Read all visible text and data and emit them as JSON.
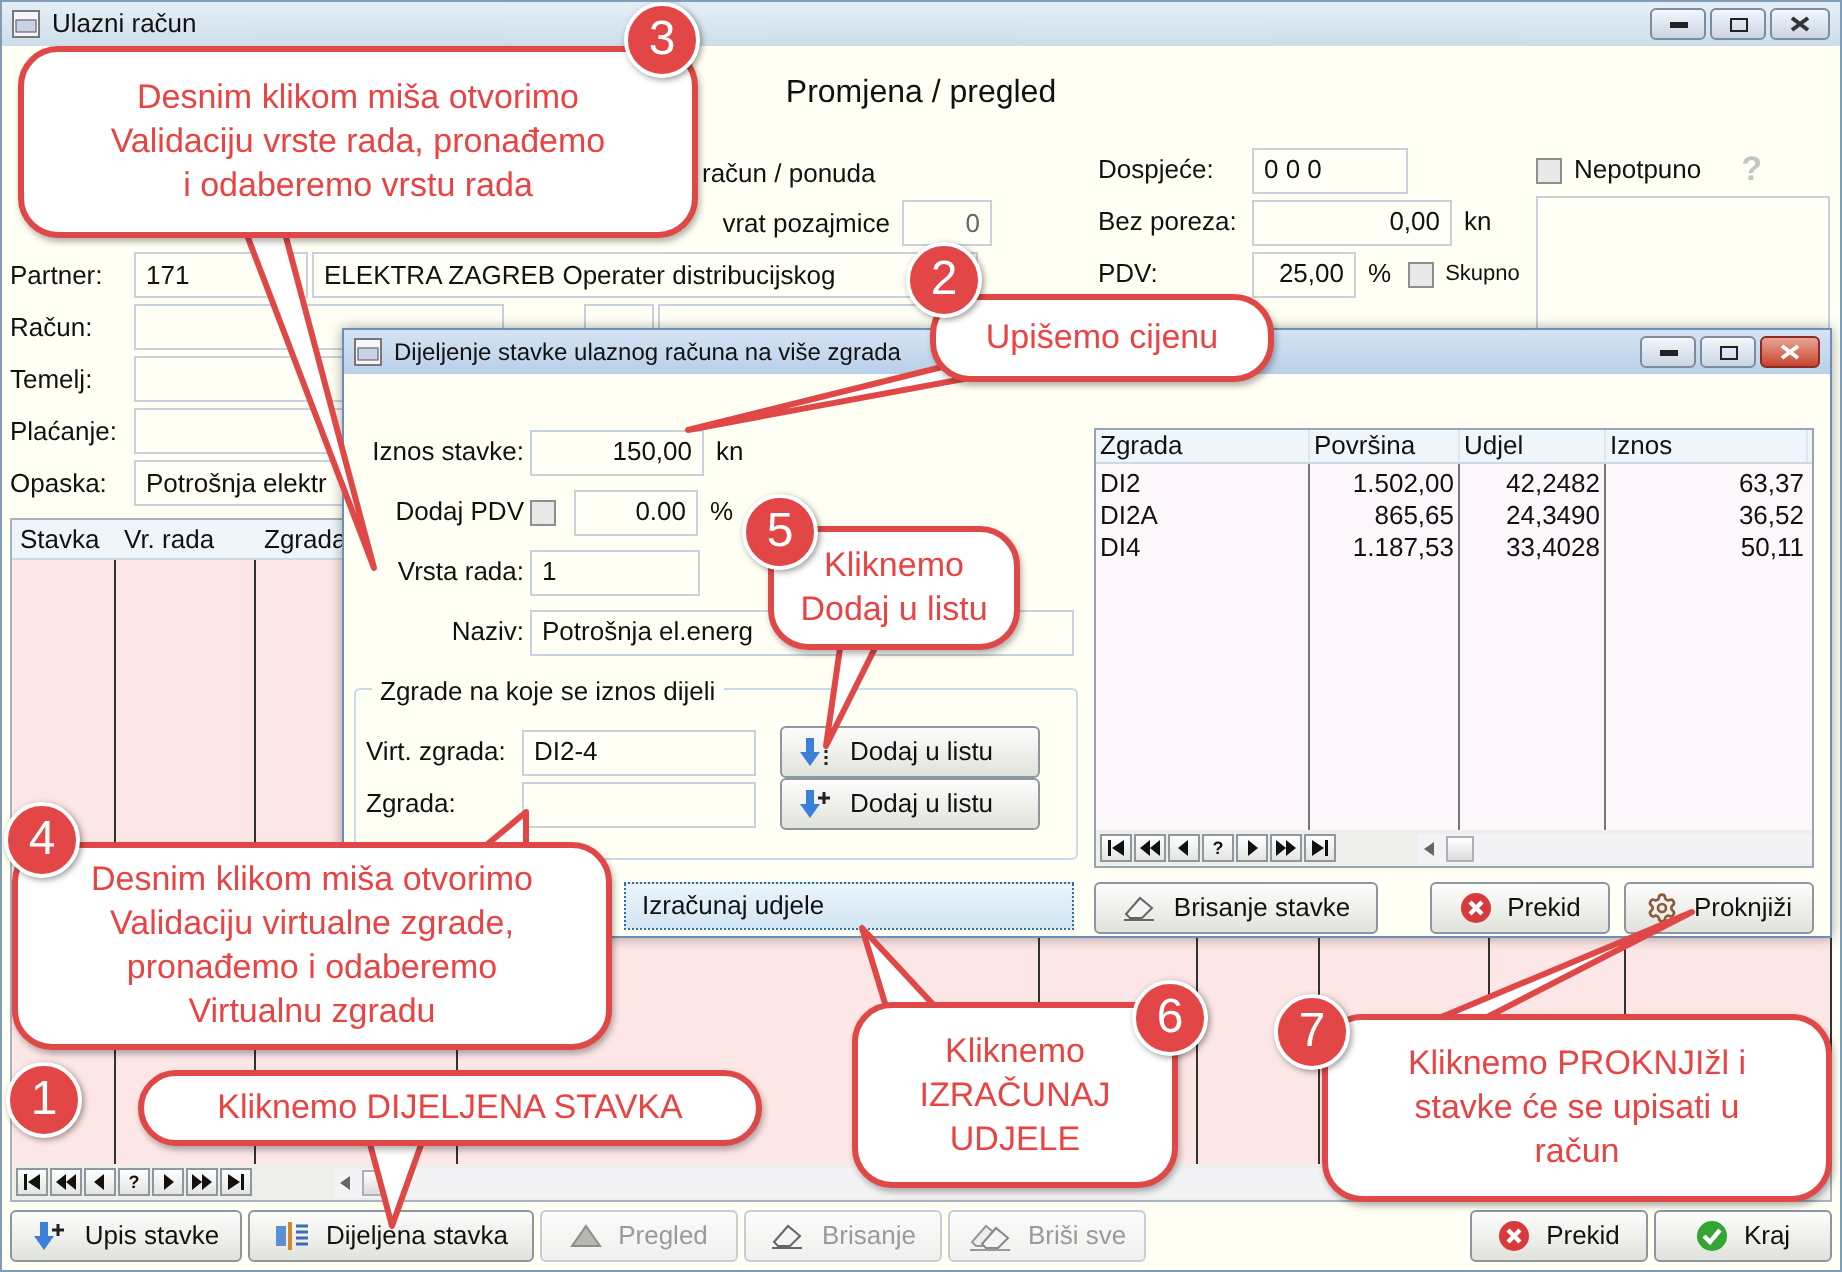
{
  "window": {
    "title": "Ulazni račun"
  },
  "heading": "Promjena / pregled",
  "top_labels": [
    {
      "label": "račun / ponuda"
    },
    {
      "label": "vrat pozajmice",
      "value": "0"
    }
  ],
  "left_fields": [
    {
      "kind": "code_name",
      "label": "Partner:",
      "code": "171",
      "value": "ELEKTRA ZAGREB Operater distribucijskog"
    },
    {
      "kind": "split",
      "label": "Račun:"
    },
    {
      "kind": "text",
      "label": "Temelj:"
    },
    {
      "kind": "text",
      "label": "Plaćanje:"
    },
    {
      "kind": "text",
      "label": "Opaska:",
      "value": "Potrošnja elektr"
    }
  ],
  "right_fields": [
    {
      "label": "Dospjeće:",
      "value": "0 0 0"
    },
    {
      "label": "Bez poreza:",
      "value": "0,00",
      "unit": "kn"
    },
    {
      "label": "PDV:",
      "value": "25,00",
      "unit": "%",
      "checkbox": {
        "label": "Skupno",
        "checked": false
      }
    }
  ],
  "nepotpuno": {
    "label": "Nepotpuno",
    "checked": false,
    "help": "?"
  },
  "items_table": {
    "columns": [
      "Stavka",
      "Vr. rada",
      "Zgrada"
    ],
    "pager_help": "?"
  },
  "bottom_buttons": [
    {
      "kind": "add",
      "label": "Upis stavke",
      "disabled": false
    },
    {
      "kind": "split",
      "label": "Dijeljena stavka",
      "disabled": false
    },
    {
      "kind": "view",
      "label": "Pregled",
      "disabled": true
    },
    {
      "kind": "erase",
      "label": "Brisanje",
      "disabled": true
    },
    {
      "kind": "erase_all",
      "label": "Briši sve",
      "disabled": true
    },
    {
      "kind": "cancel",
      "label": "Prekid",
      "disabled": false
    },
    {
      "kind": "ok",
      "label": "Kraj",
      "disabled": false
    }
  ],
  "dialog": {
    "title": "Dijeljenje stavke ulaznog računa na više zgrada",
    "iznos": {
      "label": "Iznos stavke:",
      "value": "150,00",
      "unit": "kn"
    },
    "pdv": {
      "label": "Dodaj PDV",
      "checked": false,
      "value": "0.00",
      "unit": "%"
    },
    "vrsta": {
      "label": "Vrsta rada:",
      "value": "1"
    },
    "naziv": {
      "label": "Naziv:",
      "value": "Potrošnja el.energ"
    },
    "group": {
      "title": "Zgrade na koje se iznos dijeli",
      "rows": [
        {
          "kind": "list",
          "label": "Virt. zgrada:",
          "value": "DI2-4",
          "button": "Dodaj u listu"
        },
        {
          "kind": "add",
          "label": "Zgrada:",
          "button": "Dodaj u listu"
        }
      ]
    },
    "calc_button": "Izračunaj udjele",
    "grid": {
      "columns": [
        "Zgrada",
        "Površina",
        "Udjel",
        "Iznos"
      ],
      "rows": [
        [
          "DI2",
          "1.502,00",
          "42,2482",
          "63,37"
        ],
        [
          "DI2A",
          "865,65",
          "24,3490",
          "36,52"
        ],
        [
          "DI4",
          "1.187,53",
          "33,4028",
          "50,11"
        ]
      ],
      "pager_help": "?"
    },
    "buttons": [
      {
        "kind": "erase",
        "label": "Brisanje stavke"
      },
      {
        "kind": "cancel",
        "label": "Prekid"
      },
      {
        "kind": "gear",
        "label": "Proknjiži"
      }
    ]
  },
  "callouts": [
    {
      "number": "1",
      "text": "Kliknemo DIJELJENA STAVKA"
    },
    {
      "number": "2",
      "text": "Upišemo cijenu"
    },
    {
      "number": "3",
      "text": "Desnim klikom miša otvorimo\nValidaciju vrste rada, pronađemo\ni odaberemo vrstu rada"
    },
    {
      "number": "4",
      "text": "Desnim klikom miša otvorimo\nValidaciju virtualne zgrade,\npronađemo i odaberemo\nVirtualnu  zgradu"
    },
    {
      "number": "5",
      "text": "Kliknemo\nDodaj u listu"
    },
    {
      "number": "6",
      "text": "Kliknemo\nIZRAČUNAJ\nUDJELE"
    },
    {
      "number": "7",
      "text": "Kliknemo PROKNJIžl i\nstavke će se upisati u\nračun"
    }
  ]
}
